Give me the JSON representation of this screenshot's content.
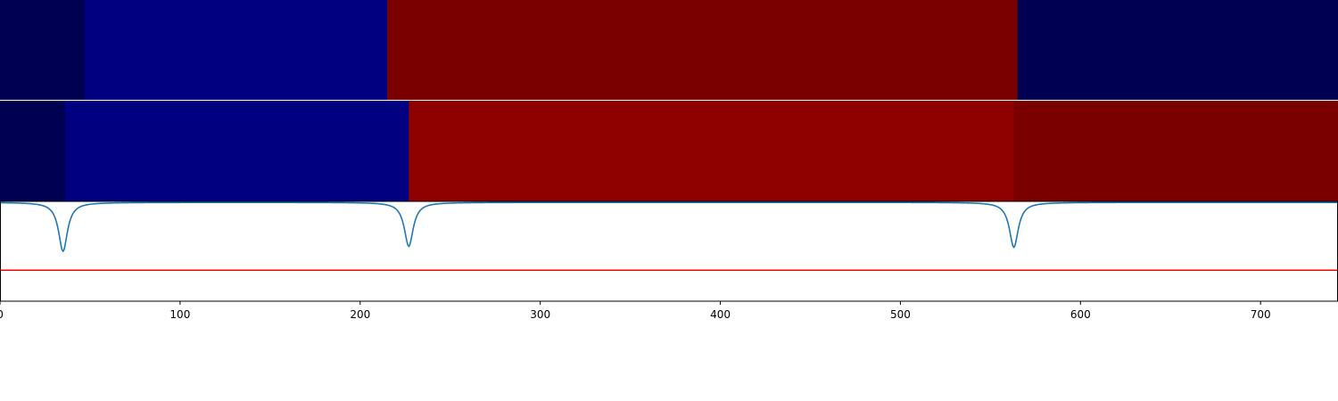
{
  "chart_data": [
    {
      "type": "heatmap",
      "panel": "segmentation-row-1",
      "xlim": [
        0,
        743
      ],
      "segments": [
        {
          "start": 0,
          "end": 47,
          "color": "#000050"
        },
        {
          "start": 47,
          "end": 215,
          "color": "#000080"
        },
        {
          "start": 215,
          "end": 565,
          "color": "#7a0000"
        },
        {
          "start": 565,
          "end": 743,
          "color": "#000050"
        }
      ]
    },
    {
      "type": "heatmap",
      "panel": "segmentation-row-2",
      "xlim": [
        0,
        743
      ],
      "segments": [
        {
          "start": 0,
          "end": 36,
          "color": "#000050"
        },
        {
          "start": 36,
          "end": 227,
          "color": "#000080"
        },
        {
          "start": 227,
          "end": 563,
          "color": "#8f0000"
        },
        {
          "start": 563,
          "end": 743,
          "color": "#7a0000"
        }
      ]
    },
    {
      "type": "line",
      "panel": "boundary-score",
      "xlim": [
        0,
        743
      ],
      "ylim": [
        0,
        1
      ],
      "grid": false,
      "xticks": [
        0,
        100,
        200,
        300,
        400,
        500,
        600,
        700
      ],
      "series": [
        {
          "color": "#1f77b4",
          "baseline": 0.99,
          "dips": [
            {
              "center": 35,
              "min": 0.5,
              "width": 3
            },
            {
              "center": 227,
              "min": 0.55,
              "width": 3
            },
            {
              "center": 563,
              "min": 0.54,
              "width": 3
            }
          ]
        }
      ],
      "threshold": {
        "value": 0.31,
        "color": "#ff0000"
      }
    }
  ]
}
